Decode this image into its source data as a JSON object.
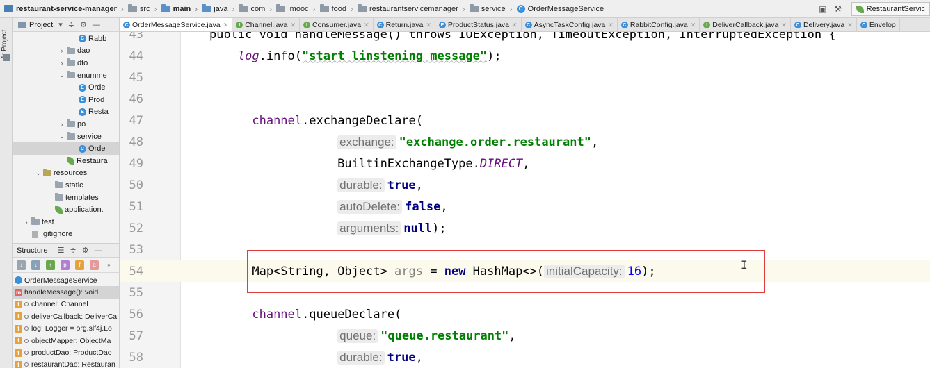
{
  "breadcrumb": [
    {
      "label": "restaurant-service-manager",
      "icon": "project-icon",
      "bold": true
    },
    {
      "label": "src",
      "icon": "folder-icon"
    },
    {
      "label": "main",
      "icon": "folder-icon",
      "bold": true
    },
    {
      "label": "java",
      "icon": "folder-icon"
    },
    {
      "label": "com",
      "icon": "folder-icon"
    },
    {
      "label": "imooc",
      "icon": "folder-icon"
    },
    {
      "label": "food",
      "icon": "folder-icon"
    },
    {
      "label": "restaurantservicemanager",
      "icon": "folder-icon"
    },
    {
      "label": "service",
      "icon": "folder-icon"
    },
    {
      "label": "OrderMessageService",
      "icon": "class-icon"
    }
  ],
  "run_config": "RestaurantServic",
  "tool_strip": {
    "project_label": "1: Project"
  },
  "project_panel": {
    "title": "Project",
    "tree": [
      {
        "label": "Rabb",
        "icon": "class",
        "indent": 115,
        "arrow": ""
      },
      {
        "label": "dao",
        "icon": "folder",
        "indent": 98,
        "arrow": "›"
      },
      {
        "label": "dto",
        "icon": "folder",
        "indent": 98,
        "arrow": "›"
      },
      {
        "label": "enumme",
        "icon": "folder",
        "indent": 98,
        "arrow": "⌄"
      },
      {
        "label": "Orde",
        "icon": "enum",
        "indent": 115,
        "arrow": ""
      },
      {
        "label": "Prod",
        "icon": "enum",
        "indent": 115,
        "arrow": ""
      },
      {
        "label": "Resta",
        "icon": "enum",
        "indent": 115,
        "arrow": ""
      },
      {
        "label": "po",
        "icon": "folder",
        "indent": 98,
        "arrow": "›"
      },
      {
        "label": "service",
        "icon": "folder",
        "indent": 98,
        "arrow": "⌄"
      },
      {
        "label": "Orde",
        "icon": "class",
        "indent": 115,
        "arrow": "",
        "selected": true
      },
      {
        "label": "Restaura",
        "icon": "spring",
        "indent": 98,
        "arrow": ""
      },
      {
        "label": "resources",
        "icon": "res",
        "indent": 64,
        "arrow": "⌄"
      },
      {
        "label": "static",
        "icon": "folder",
        "indent": 81,
        "arrow": ""
      },
      {
        "label": "templates",
        "icon": "folder",
        "indent": 81,
        "arrow": ""
      },
      {
        "label": "application.",
        "icon": "spring",
        "indent": 81,
        "arrow": ""
      },
      {
        "label": "test",
        "icon": "folder",
        "indent": 47,
        "arrow": "›"
      },
      {
        "label": ".gitignore",
        "icon": "file",
        "indent": 47,
        "arrow": ""
      }
    ]
  },
  "structure_panel": {
    "title": "Structure",
    "items": [
      {
        "label": "OrderMessageService",
        "badge": "",
        "selected": false
      },
      {
        "label": "handleMessage(): void",
        "badge": "m",
        "selected": true
      },
      {
        "label": "channel: Channel",
        "badge": "f",
        "selected": false
      },
      {
        "label": "deliverCallback: DeliverCa",
        "badge": "f",
        "selected": false
      },
      {
        "label": "log: Logger = org.slf4j.Lo",
        "badge": "f",
        "selected": false
      },
      {
        "label": "objectMapper: ObjectMa",
        "badge": "f",
        "selected": false
      },
      {
        "label": "productDao: ProductDao",
        "badge": "f",
        "selected": false
      },
      {
        "label": "restaurantDao: Restauran",
        "badge": "f",
        "selected": false
      }
    ]
  },
  "tabs": [
    {
      "label": "OrderMessageService.java",
      "icon": "c",
      "active": true
    },
    {
      "label": "Channel.java",
      "icon": "i",
      "active": false
    },
    {
      "label": "Consumer.java",
      "icon": "i",
      "active": false
    },
    {
      "label": "Return.java",
      "icon": "c",
      "active": false
    },
    {
      "label": "ProductStatus.java",
      "icon": "e",
      "active": false
    },
    {
      "label": "AsyncTaskConfig.java",
      "icon": "c",
      "active": false
    },
    {
      "label": "RabbitConfig.java",
      "icon": "c",
      "active": false
    },
    {
      "label": "DeliverCallback.java",
      "icon": "i",
      "active": false
    },
    {
      "label": "Delivery.java",
      "icon": "c",
      "active": false
    },
    {
      "label": "Envelop",
      "icon": "c",
      "active": false
    }
  ],
  "editor": {
    "current_line": 54,
    "top_partial_line": "    public void handleMessage() throws IOException, TimeoutException, InterruptedException {",
    "top_partial_number": "43",
    "lines": [
      {
        "n": "44",
        "tokens": [
          [
            "",
            "        "
          ],
          [
            "fld ital",
            "log"
          ],
          [
            "",
            ".info("
          ],
          [
            "str squiggle",
            "\"start linstening message\""
          ],
          [
            "",
            ");"
          ]
        ]
      },
      {
        "n": "45",
        "tokens": []
      },
      {
        "n": "46",
        "tokens": []
      },
      {
        "n": "47",
        "tokens": [
          [
            "",
            "          "
          ],
          [
            "fld",
            "channel"
          ],
          [
            "",
            ".exchangeDeclare("
          ]
        ]
      },
      {
        "n": "48",
        "tokens": [
          [
            "",
            "                      "
          ],
          [
            "hint",
            "exchange:"
          ],
          [
            "str",
            "\"exchange.order.restaurant\""
          ],
          [
            "",
            ","
          ]
        ]
      },
      {
        "n": "49",
        "tokens": [
          [
            "",
            "                      BuiltinExchangeType."
          ],
          [
            "fld ital",
            "DIRECT"
          ],
          [
            "",
            ","
          ]
        ]
      },
      {
        "n": "50",
        "tokens": [
          [
            "",
            "                      "
          ],
          [
            "hint",
            "durable:"
          ],
          [
            "kw",
            "true"
          ],
          [
            "",
            ","
          ]
        ]
      },
      {
        "n": "51",
        "tokens": [
          [
            "",
            "                      "
          ],
          [
            "hint",
            "autoDelete:"
          ],
          [
            "kw",
            "false"
          ],
          [
            "",
            ","
          ]
        ]
      },
      {
        "n": "52",
        "tokens": [
          [
            "",
            "                      "
          ],
          [
            "hint",
            "arguments:"
          ],
          [
            "kw",
            "null"
          ],
          [
            "",
            ");"
          ]
        ]
      },
      {
        "n": "53",
        "tokens": []
      },
      {
        "n": "54",
        "tokens": [
          [
            "",
            "          Map<String, Object> "
          ],
          [
            "gray",
            "args"
          ],
          [
            "",
            " = "
          ],
          [
            "kw",
            "new"
          ],
          [
            "",
            " HashMap<>("
          ],
          [
            "hint",
            "initialCapacity:"
          ],
          [
            "num",
            "16"
          ],
          [
            "",
            ");"
          ]
        ]
      },
      {
        "n": "55",
        "tokens": []
      },
      {
        "n": "56",
        "tokens": [
          [
            "",
            "          "
          ],
          [
            "fld",
            "channel"
          ],
          [
            "",
            ".queueDeclare("
          ]
        ]
      },
      {
        "n": "57",
        "tokens": [
          [
            "",
            "                      "
          ],
          [
            "hint",
            "queue:"
          ],
          [
            "str",
            "\"queue.restaurant\""
          ],
          [
            "",
            ","
          ]
        ]
      },
      {
        "n": "58",
        "tokens": [
          [
            "",
            "                      "
          ],
          [
            "hint",
            "durable:"
          ],
          [
            "kw",
            "true"
          ],
          [
            "",
            ","
          ]
        ]
      }
    ]
  },
  "colors": {
    "highlight_box": "#e03c3c",
    "current_line": "#fcfaed",
    "keyword": "#000080",
    "string": "#008000",
    "field": "#660e7a"
  }
}
